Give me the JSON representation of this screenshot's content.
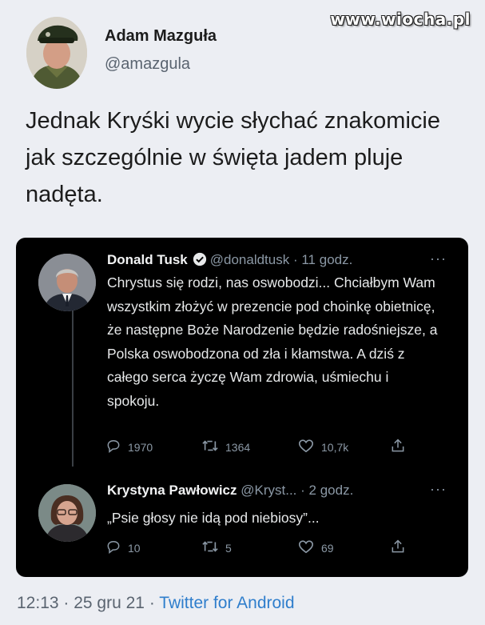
{
  "watermark": "www.wiocha.pl",
  "tweet": {
    "author_name": "Adam Mazguła",
    "author_handle": "@amazgula",
    "text": "Jednak Kryśki wycie słychać znakomicie jak szczególnie w święta jadem pluje nadęta.",
    "footer": {
      "time": "12:13",
      "sep1": " · ",
      "date": "25 gru 21",
      "sep2": " · ",
      "source": "Twitter for Android"
    }
  },
  "quoted": {
    "tweets": [
      {
        "name": "Donald Tusk",
        "handle": "@donaldtusk",
        "time": "· 11 godz.",
        "text": "Chrystus się rodzi, nas oswobodzi... Chciałbym Wam wszystkim złożyć w prezencie pod choinkę obietnicę, że następne Boże Narodzenie będzie radośniejsze, a Polska oswobodzona od zła i kłamstwa. A dziś z całego serca życzę Wam zdrowia, uśmiechu i spokoju.",
        "replies": "1970",
        "retweets": "1364",
        "likes": "10,7k",
        "more": "···"
      },
      {
        "name": "Krystyna Pawłowicz",
        "handle": "@Kryst...",
        "time": "· 2 godz.",
        "text": "„Psie głosy nie idą pod niebiosy”...",
        "replies": "10",
        "retweets": "5",
        "likes": "69",
        "more": "···"
      }
    ]
  },
  "colors": {
    "page_bg": "#eceef3",
    "card_bg": "#000000",
    "verified": "#1d9bf0",
    "link": "#2f7ecc"
  }
}
